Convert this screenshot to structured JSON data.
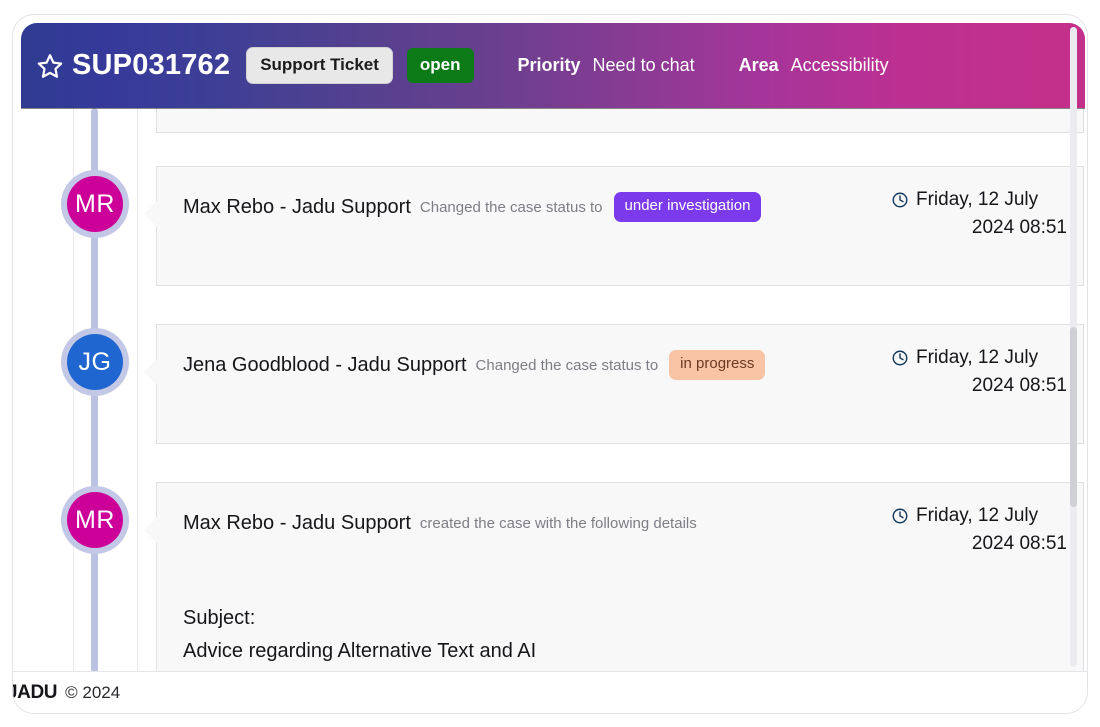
{
  "header": {
    "star_icon": "star-outline-icon",
    "ticket_ref": "SUP031762",
    "type_label": "Support Ticket",
    "status_label": "open",
    "priority_label": "Priority",
    "priority_value": "Need to chat",
    "area_label": "Area",
    "area_value": "Accessibility",
    "gradient_start": "#2f3c91",
    "gradient_end": "#c3308c",
    "status_color": "#0c7a16"
  },
  "timeline": {
    "spine_color": "#bcc2e2",
    "entries": [
      {
        "avatar_initials": "MR",
        "avatar_color": "#cc0099",
        "avatar_ring_color": "#c3c8e6",
        "actor": "Max Rebo - Jadu Support",
        "action": "Changed the case status to",
        "badge_text": "under investigation",
        "badge_style": "investigation",
        "badge_color": "#7c3aed",
        "date_line1": "Friday, 12 July",
        "date_line2": "2024 08:51",
        "clock_icon": "clock-icon"
      },
      {
        "avatar_initials": "JG",
        "avatar_color": "#1f66d0",
        "avatar_ring_color": "#c3c8e6",
        "actor": "Jena Goodblood - Jadu Support",
        "action": "Changed the case status to",
        "badge_text": "in progress",
        "badge_style": "progress",
        "badge_color": "#f9c4a5",
        "date_line1": "Friday, 12 July",
        "date_line2": "2024 08:51",
        "clock_icon": "clock-icon"
      },
      {
        "avatar_initials": "MR",
        "avatar_color": "#cc0099",
        "avatar_ring_color": "#c3c8e6",
        "actor": "Max Rebo - Jadu Support",
        "action": "created the case with the following details",
        "badge_text": "",
        "badge_style": "none",
        "badge_color": "",
        "date_line1": "Friday, 12 July",
        "date_line2": "2024 08:51",
        "clock_icon": "clock-icon",
        "subject_label": "Subject:",
        "subject_value": "Advice regarding Alternative Text and AI"
      }
    ]
  },
  "footer": {
    "brand": "JADU",
    "copyright": "© 2024"
  }
}
